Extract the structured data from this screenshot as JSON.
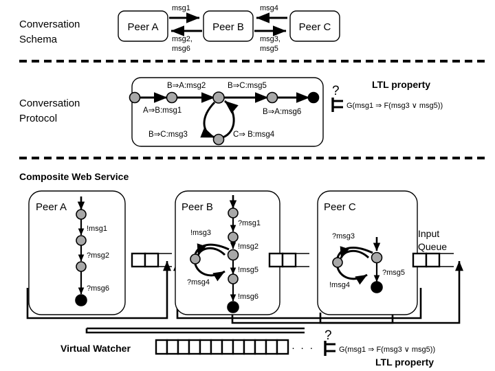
{
  "sections": {
    "schema_label": "Conversation\nSchema",
    "schema_label_l1": "Conversation",
    "schema_label_l2": "Schema",
    "protocol_label_l1": "Conversation",
    "protocol_label_l2": "Protocol",
    "composite_label": "Composite Web Service"
  },
  "conversation_schema": {
    "peers": [
      {
        "id": "A",
        "label": "Peer A"
      },
      {
        "id": "B",
        "label": "Peer B"
      },
      {
        "id": "C",
        "label": "Peer C"
      }
    ],
    "channels": [
      {
        "from": "A",
        "to": "B",
        "label": "msg1"
      },
      {
        "from": "B",
        "to": "A",
        "label_l1": "msg2,",
        "label_l2": "msg6"
      },
      {
        "from": "C",
        "to": "B",
        "label": "msg4"
      },
      {
        "from": "B",
        "to": "C",
        "label_l1": "msg3,",
        "label_l2": "msg5"
      }
    ]
  },
  "conversation_protocol": {
    "states": [
      "s0",
      "s1",
      "s2",
      "s3",
      "s4",
      "s5"
    ],
    "final_state": "s4",
    "transitions": [
      {
        "from": "s0",
        "to": "s1",
        "label": "A⇒B:msg1"
      },
      {
        "from": "s1",
        "to": "s2",
        "label": "B⇒A:msg2"
      },
      {
        "from": "s2",
        "to": "s3",
        "label": "B⇒C:msg3"
      },
      {
        "from": "s3",
        "to": "s2",
        "label": "C⇒ B:msg4"
      },
      {
        "from": "s2",
        "to": "s4",
        "label": "B⇒C:msg5"
      },
      {
        "from": "s4",
        "to": "s5",
        "label": "B⇒A:msg6"
      }
    ]
  },
  "ltl_top": {
    "question_mark": "?",
    "models_symbol": "⊨",
    "title": "LTL property",
    "formula": "G(msg1 ⇒ F(msg3 ∨ msg5))"
  },
  "composite": {
    "input_queue_label_l1": "Input",
    "input_queue_label_l2": "Queue",
    "input_queue_cells": 2,
    "peers": [
      {
        "label": "Peer A",
        "transitions": [
          "!msg1",
          "?msg2",
          "?msg6"
        ],
        "loop_labels": []
      },
      {
        "label": "Peer B",
        "transitions": [
          "?msg1",
          "!msg2",
          "!msg5",
          "!msg6"
        ],
        "loop_labels": [
          "!msg3",
          "?msg4"
        ]
      },
      {
        "label": "Peer C",
        "transitions": [
          "?msg5"
        ],
        "loop_labels": [
          "?msg3",
          "!msg4"
        ]
      }
    ]
  },
  "virtual_watcher": {
    "label": "Virtual Watcher",
    "queue_cells": 12,
    "ellipsis": "· · ·",
    "question_mark": "?",
    "models_symbol": "⊨",
    "formula": "G(msg1 ⇒ F(msg3 ∨ msg5))",
    "title": "LTL property"
  },
  "colors": {
    "state_fill": "#a8a8a8",
    "final_fill": "#000000",
    "stroke": "#000000",
    "background": "#ffffff"
  }
}
